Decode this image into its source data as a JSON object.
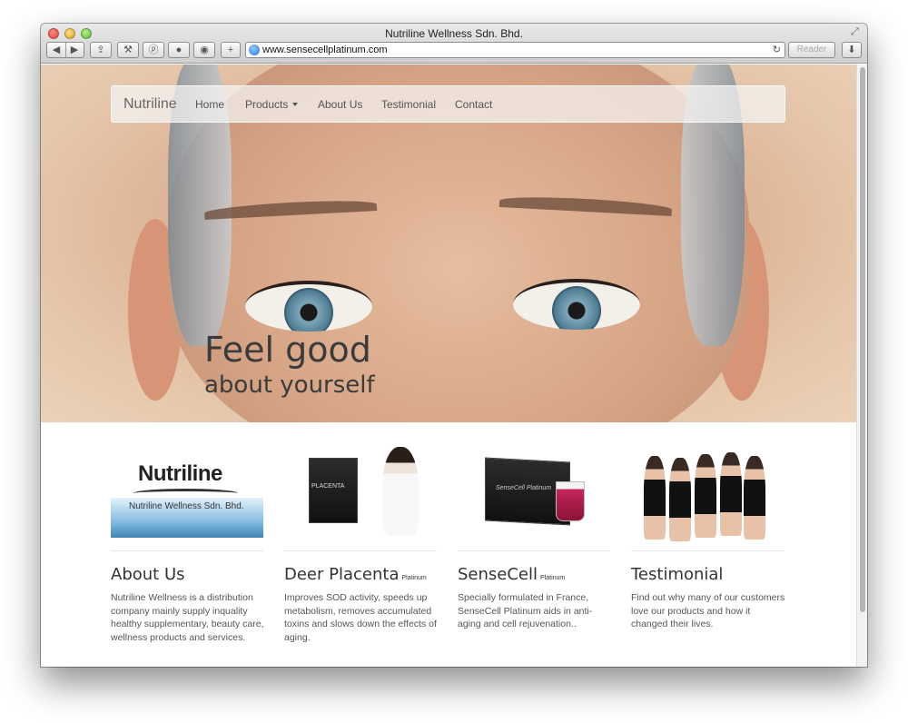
{
  "window": {
    "title": "Nutriline Wellness Sdn. Bhd.",
    "url": "www.sensecellplatinum.com",
    "reader_label": "Reader",
    "toolbar_icons": [
      "back-icon",
      "forward-icon",
      "share-icon",
      "wrench-icon",
      "pinterest-icon",
      "circle-icon",
      "shield-icon",
      "plus-icon",
      "globe-icon",
      "reload-icon",
      "download-icon",
      "fullscreen-icon"
    ]
  },
  "navbar": {
    "brand": "Nutriline",
    "items": [
      {
        "label": "Home"
      },
      {
        "label": "Products"
      },
      {
        "label": "About Us"
      },
      {
        "label": "Testimonial"
      },
      {
        "label": "Contact"
      }
    ]
  },
  "hero": {
    "title": "Feel good",
    "subtitle": "about yourself"
  },
  "columns": [
    {
      "title": "About Us",
      "tag": "",
      "text": "Nutriline Wellness is a distribution company mainly supply inquality healthy supplementary, beauty care, wellness products and services.",
      "image_logo_word": "Nutriline",
      "image_logo_tag": "Nutriline Wellness Sdn. Bhd."
    },
    {
      "title": "Deer Placenta",
      "tag": "Platinum",
      "text": "Improves SOD activity, speeds up metabolism, removes accumulated toxins and slows down the effects of aging.",
      "image_box_label": "PLACENTA"
    },
    {
      "title": "SenseCell",
      "tag": "Platinum",
      "text": "Specially formulated in France, SenseCell Platinum aids in anti-aging and cell rejuvenation..",
      "image_box_label": "SenseCell Platinum"
    },
    {
      "title": "Testimonial",
      "tag": "",
      "text": "Find out why many of our customers love our products and how it changed their lives."
    }
  ],
  "colors": {
    "hero_text": "#3b3b3b",
    "navbar_bg": "#f5f5f5",
    "body_text": "#555555"
  }
}
